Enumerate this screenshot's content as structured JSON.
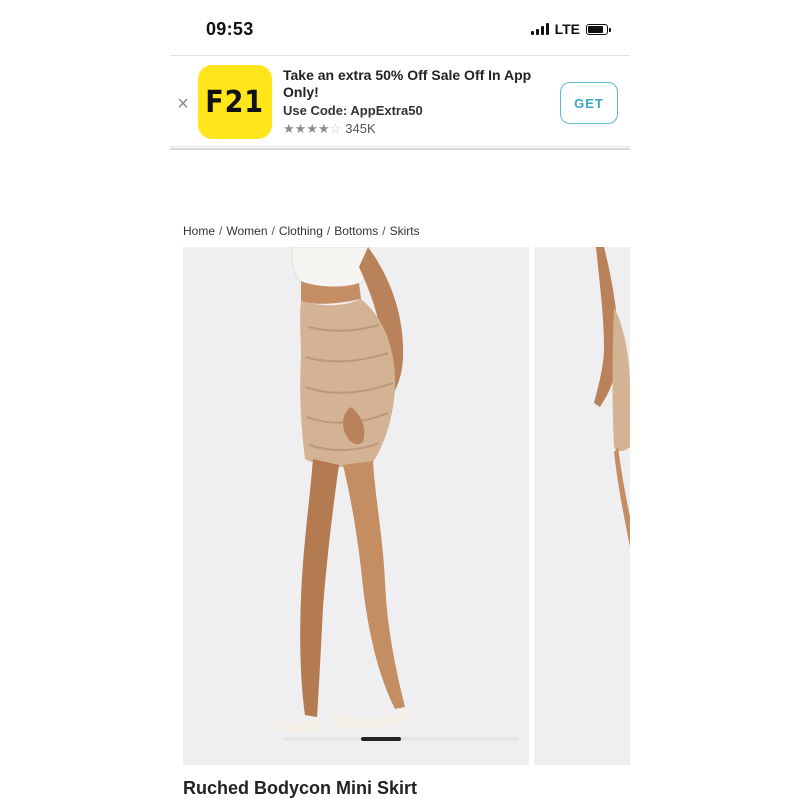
{
  "status_bar": {
    "time": "09:53",
    "network": "LTE",
    "icons": [
      "signal-icon",
      "battery-icon"
    ]
  },
  "app_banner": {
    "close_symbol": "×",
    "app_icon_text": "F21",
    "app_icon_color": "#ffe51a",
    "title": "Take an extra 50% Off Sale Off In App Only!",
    "code_line": "Use Code: AppExtra50",
    "rating": 4.5,
    "rating_count": "345K",
    "get_label": "GET",
    "get_color": "#3aa6c2"
  },
  "breadcrumb": {
    "items": [
      "Home",
      "Women",
      "Clothing",
      "Bottoms",
      "Skirts"
    ],
    "separator": "/"
  },
  "gallery": {
    "images": [
      "product-photo-side-view",
      "product-photo-back-view"
    ],
    "background": "#efeff1",
    "scroll_position": 0.33
  },
  "product": {
    "title": "Ruched Bodycon Mini Skirt",
    "skirt_color": "#d3b394"
  }
}
